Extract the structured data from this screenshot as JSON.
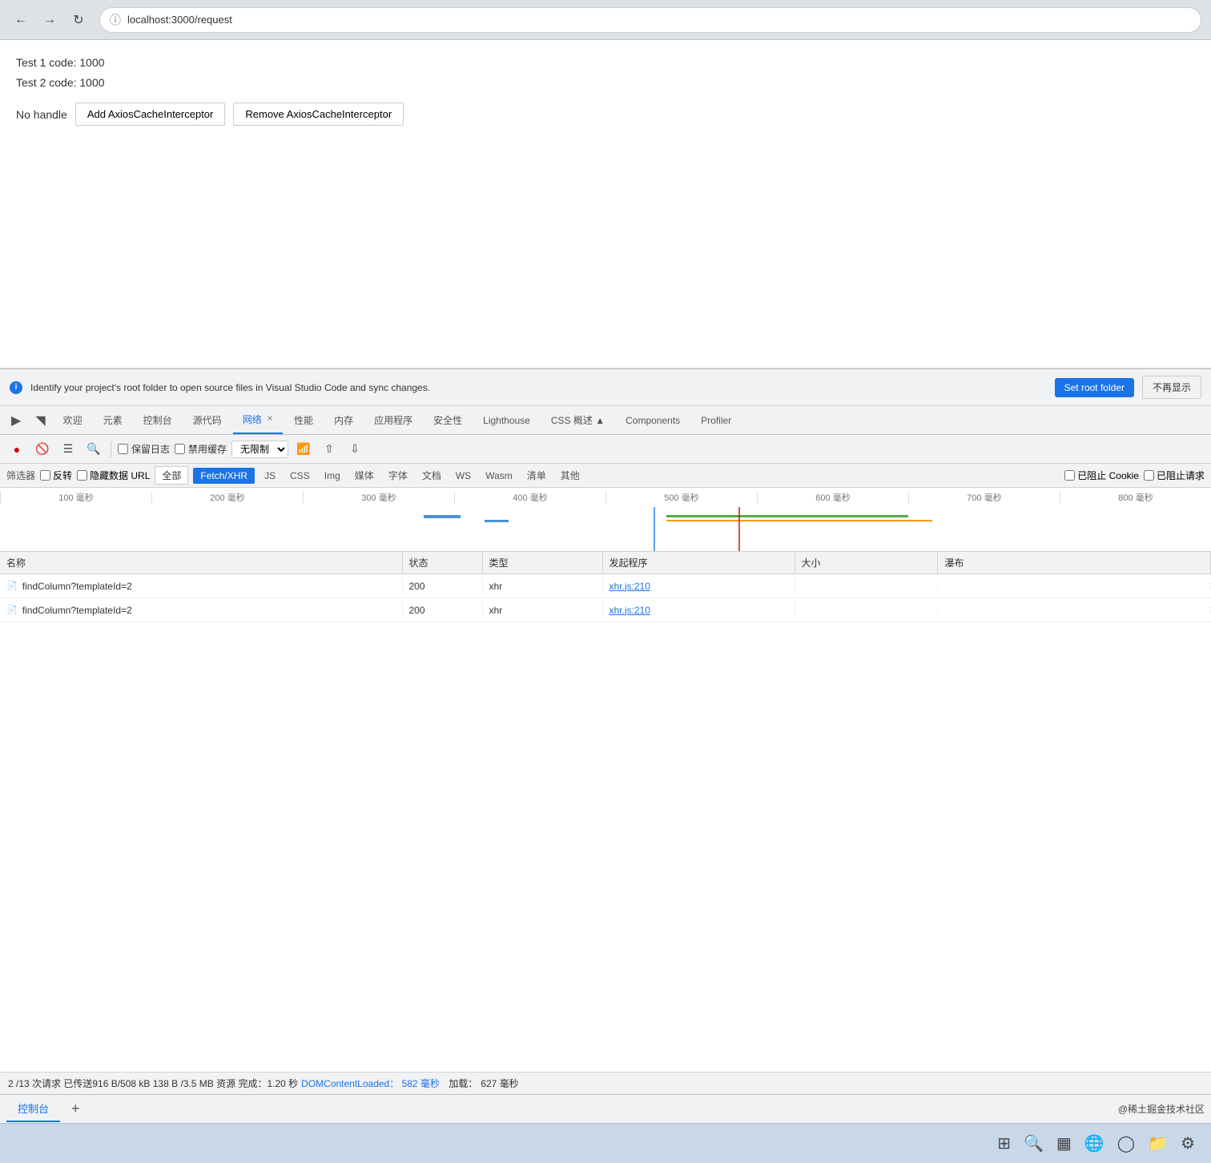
{
  "browser": {
    "url": "localhost:3000/request",
    "back_tooltip": "Back",
    "forward_tooltip": "Forward",
    "refresh_tooltip": "Refresh"
  },
  "page": {
    "test1": "Test 1 code: 1000",
    "test2": "Test 2 code: 1000",
    "label": "No handle",
    "btn_add": "Add AxiosCacheInterceptor",
    "btn_remove": "Remove AxiosCacheInterceptor"
  },
  "banner": {
    "text": "Identify your project's root folder to open source files in Visual Studio Code and sync changes.",
    "btn_set": "Set root folder",
    "btn_dismiss": "不再显示"
  },
  "devtools": {
    "tabs": [
      {
        "label": "欢迎",
        "active": false,
        "closable": false
      },
      {
        "label": "元素",
        "active": false,
        "closable": false
      },
      {
        "label": "控制台",
        "active": false,
        "closable": false
      },
      {
        "label": "源代码",
        "active": false,
        "closable": false
      },
      {
        "label": "网络",
        "active": true,
        "closable": true
      },
      {
        "label": "性能",
        "active": false,
        "closable": false
      },
      {
        "label": "内存",
        "active": false,
        "closable": false
      },
      {
        "label": "应用程序",
        "active": false,
        "closable": false
      },
      {
        "label": "安全性",
        "active": false,
        "closable": false
      },
      {
        "label": "Lighthouse",
        "active": false,
        "closable": false
      },
      {
        "label": "CSS 概述 ▲",
        "active": false,
        "closable": false
      },
      {
        "label": "Components",
        "active": false,
        "closable": false
      },
      {
        "label": "Profiler",
        "active": false,
        "closable": false
      }
    ]
  },
  "toolbar": {
    "record_label": "●",
    "clear_label": "🚫",
    "filter_label": "≡",
    "search_label": "🔍",
    "preserve_log": "保留日志",
    "disable_cache": "禁用缓存",
    "throttle": "无限制",
    "wifi_icon": "📶",
    "upload_icon": "↑",
    "download_icon": "↓"
  },
  "filter": {
    "label": "筛选器",
    "invert": "反转",
    "hide_data_urls": "隐藏数据 URL",
    "all": "全部",
    "types": [
      "Fetch/XHR",
      "JS",
      "CSS",
      "Img",
      "媒体",
      "字体",
      "文档",
      "WS",
      "Wasm",
      "清单",
      "其他"
    ],
    "active_type": "Fetch/XHR",
    "blocked_cookies": "已阻止 Cookie",
    "blocked_requests": "已阻止请求"
  },
  "timeline": {
    "marks": [
      "100 毫秒",
      "200 毫秒",
      "300 毫秒",
      "400 毫秒",
      "500 毫秒",
      "600 毫秒",
      "700 毫秒",
      "800 毫秒"
    ]
  },
  "table": {
    "headers": {
      "name": "名称",
      "status": "状态",
      "type": "类型",
      "initiator": "发起程序",
      "size": "大小",
      "waterfall": "瀑布"
    },
    "rows": [
      {
        "name": "findColumn?templateId=2",
        "status": "200",
        "type": "xhr",
        "initiator": "xhr.js:210",
        "size": ""
      },
      {
        "name": "findColumn?templateId=2",
        "status": "200",
        "type": "xhr",
        "initiator": "xhr.js:210",
        "size": ""
      }
    ]
  },
  "status_bar": {
    "summary": "2 /13 次请求  已传送916 B/508 kB  138 B /3.5 MB 资源 完成：1.20 秒",
    "domcontentloaded_label": "DOMContentLoaded：",
    "domcontentloaded_value": "582 毫秒",
    "load_label": "加载：",
    "load_value": "627 毫秒"
  },
  "bottom_tabs": {
    "tabs": [
      "控制台",
      "+"
    ],
    "active": "控制台",
    "watermark": "@稀土掘金技术社区"
  }
}
